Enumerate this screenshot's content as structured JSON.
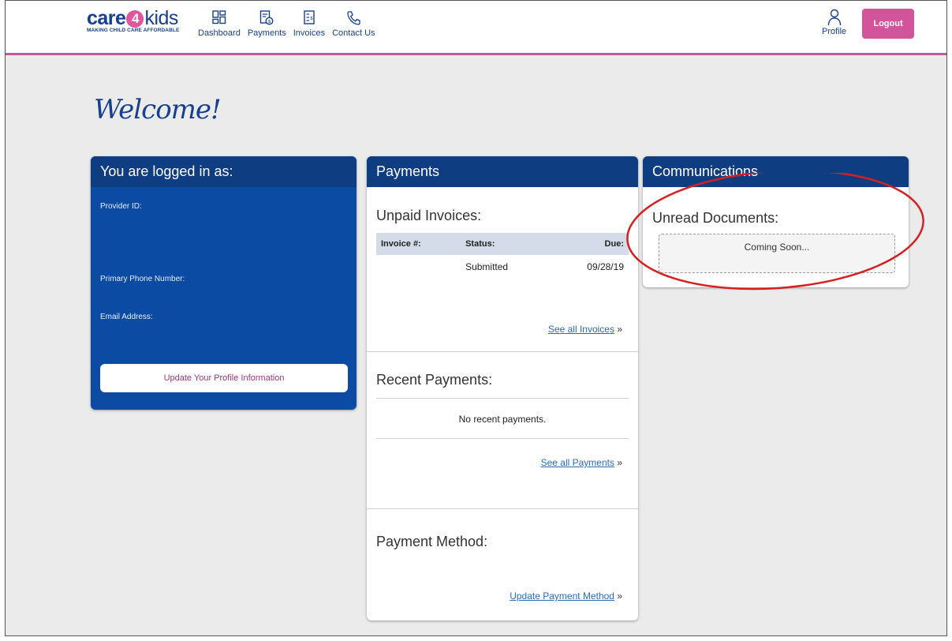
{
  "brand": {
    "logo_care": "care",
    "logo_four": "4",
    "logo_kids": "kids",
    "tagline": "MAKING CHILD CARE AFFORDABLE"
  },
  "nav": {
    "items": [
      {
        "label": "Dashboard",
        "icon": "dashboard-icon"
      },
      {
        "label": "Payments",
        "icon": "payments-icon"
      },
      {
        "label": "Invoices",
        "icon": "invoices-icon"
      },
      {
        "label": "Contact Us",
        "icon": "phone-icon"
      }
    ],
    "profile_label": "Profile",
    "logout_label": "Logout"
  },
  "welcome": "Welcome!",
  "account": {
    "title": "You are logged in as:",
    "provider_id_label": "Provider ID:",
    "phone_label": "Primary Phone Number:",
    "email_label": "Email Address:",
    "update_label": "Update Your Profile Information"
  },
  "payments": {
    "title": "Payments",
    "unpaid_title": "Unpaid Invoices:",
    "table": {
      "headers": [
        "Invoice #:",
        "Status:",
        "Due:"
      ],
      "rows": [
        {
          "invoice": "",
          "status": "Submitted",
          "due": "09/28/19"
        }
      ]
    },
    "see_invoices": "See all Invoices",
    "recent_title": "Recent Payments:",
    "no_recent": "No recent payments.",
    "see_payments": "See all Payments",
    "method_title": "Payment Method:",
    "update_method": "Update Payment Method",
    "arrow": "»"
  },
  "communications": {
    "title": "Communications",
    "unread_title": "Unread Documents:",
    "coming_soon": "Coming Soon..."
  },
  "colors": {
    "brand_blue": "#173f8f",
    "card_header": "#0f3d82",
    "account_bg": "#0b4ba3",
    "accent_pink": "#d2559c",
    "annotation_red": "#d62020"
  }
}
